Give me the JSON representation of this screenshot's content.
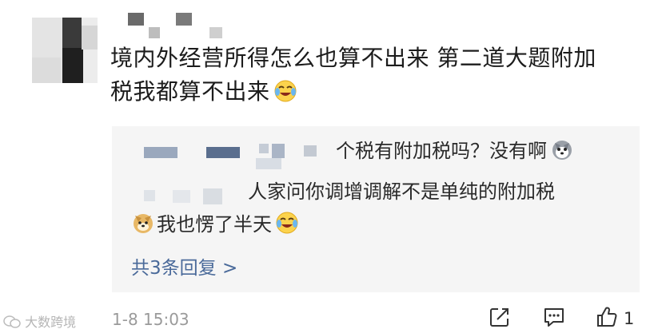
{
  "comment": {
    "text_line1": "境内外经营所得怎么也算不出来 第二道大题附加",
    "text_line2": "税我都算不出来",
    "emoji": "laugh-cry-emoji"
  },
  "replies": {
    "reply1_text": "个税有附加税吗？没有啊",
    "reply1_emoji": "husky-emoji",
    "reply2_text_a": "人家问你调增调解不是单纯的附加税",
    "reply2_emoji": "doge-emoji",
    "reply2_text_b": "我也愣了半天",
    "reply2_emoji_end": "laugh-cry-emoji",
    "more_label": "共3条回复 >"
  },
  "footer": {
    "timestamp": "1-8 15:03",
    "like_count": "1",
    "watermark": "大数跨境"
  },
  "colors": {
    "reply_bg": "#f5f5f5",
    "link": "#4a6a9a",
    "meta": "#9a9a9a"
  }
}
